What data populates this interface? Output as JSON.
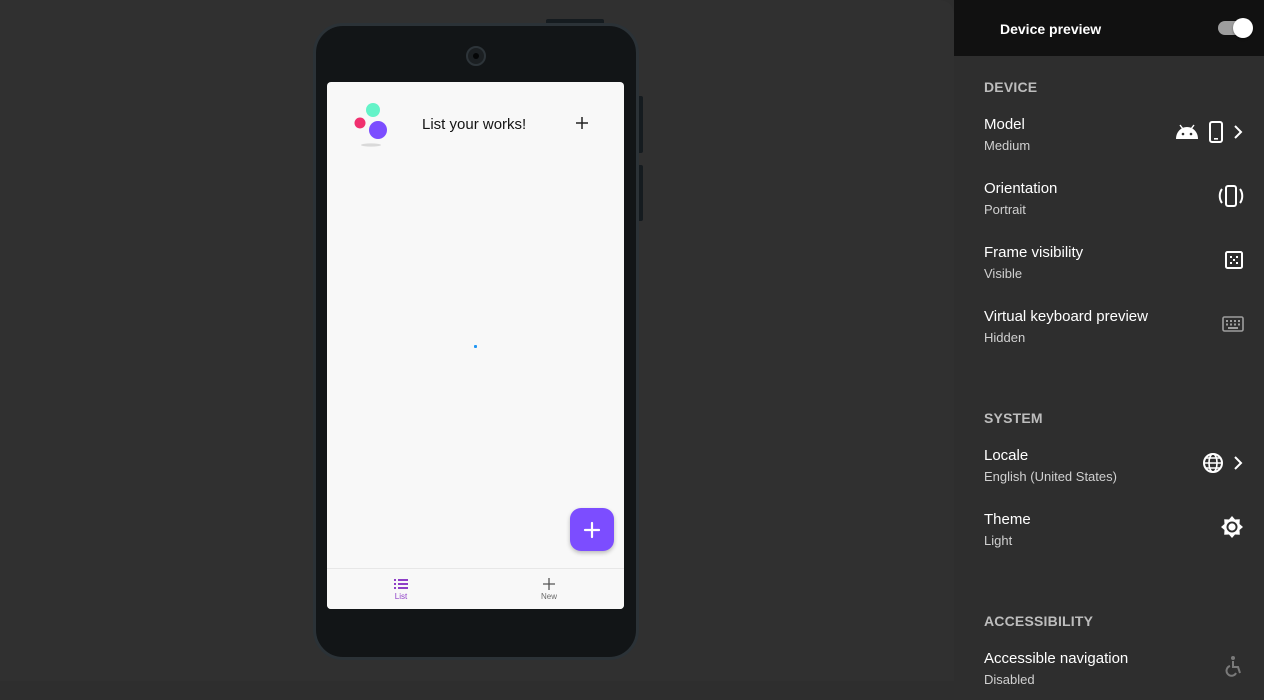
{
  "app": {
    "title": "List your works!",
    "nav": [
      {
        "label": "List"
      },
      {
        "label": "New"
      }
    ],
    "colors": {
      "accent": "#7c4dff",
      "nav_active": "#8e3fc7",
      "loader": "#2196f3"
    }
  },
  "panel": {
    "title": "Device preview",
    "toggle_on": true,
    "sections": {
      "device": "DEVICE",
      "system": "SYSTEM",
      "accessibility": "ACCESSIBILITY"
    },
    "rows": {
      "model": {
        "title": "Model",
        "value": "Medium"
      },
      "orientation": {
        "title": "Orientation",
        "value": "Portrait"
      },
      "frame": {
        "title": "Frame visibility",
        "value": "Visible"
      },
      "keyboard": {
        "title": "Virtual keyboard preview",
        "value": "Hidden"
      },
      "locale": {
        "title": "Locale",
        "value": "English (United States)"
      },
      "theme": {
        "title": "Theme",
        "value": "Light"
      },
      "accessible_nav": {
        "title": "Accessible navigation",
        "value": "Disabled"
      }
    }
  }
}
